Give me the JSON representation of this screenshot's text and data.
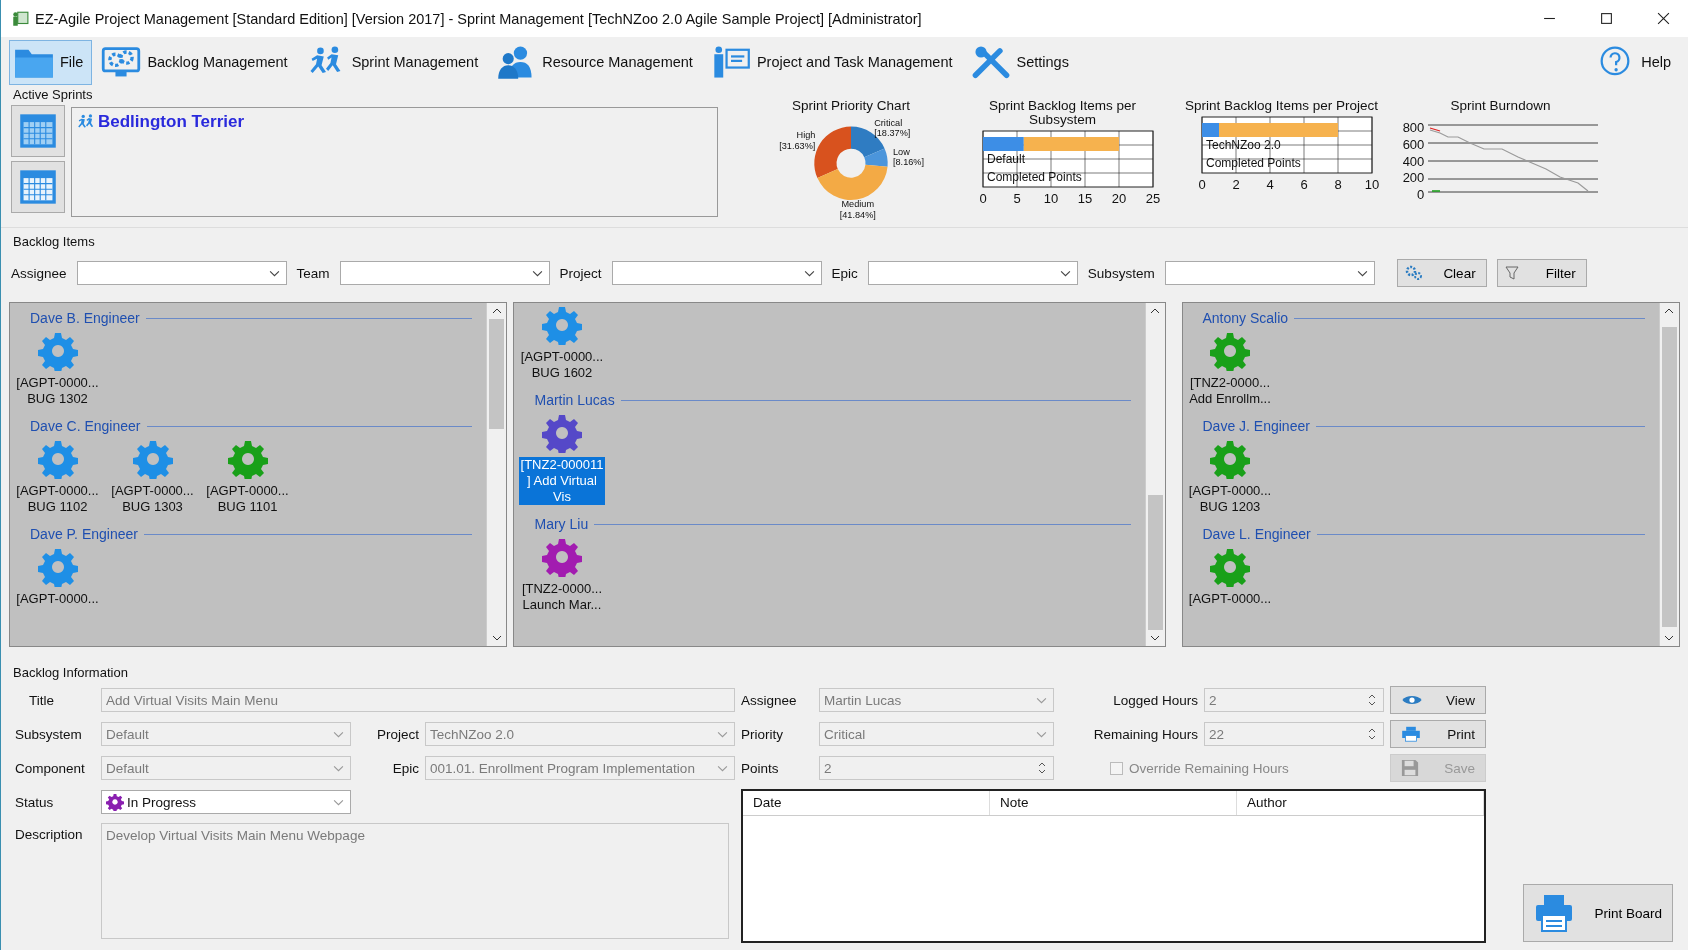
{
  "window": {
    "title": "EZ-Agile Project Management [Standard Edition] [Version 2017] - Sprint Management [TechNZoo 2.0 Agile Sample Project] [Administrator]"
  },
  "toolbar": [
    {
      "kind": "file",
      "label": "File",
      "selected": true
    },
    {
      "kind": "backlog",
      "label": "Backlog Management",
      "selected": false
    },
    {
      "kind": "sprint",
      "label": "Sprint Management",
      "selected": false
    },
    {
      "kind": "resource",
      "label": "Resource Management",
      "selected": false
    },
    {
      "kind": "project",
      "label": "Project and Task Management",
      "selected": false
    },
    {
      "kind": "settings",
      "label": "Settings",
      "selected": false
    }
  ],
  "help": {
    "label": "Help"
  },
  "active_sprints": {
    "label": "Active Sprints",
    "sprints": [
      "Bedlington Terrier"
    ]
  },
  "priority_chart": {
    "chart_data": {
      "type": "donut",
      "title": "Sprint Priority Chart",
      "categories": [
        "High",
        "Critical",
        "Low",
        "Medium"
      ],
      "series": [
        {
          "values": [
            31.63,
            18.37,
            8.16,
            41.84
          ]
        }
      ],
      "colors": [
        "#d8521e",
        "#2f7cc2",
        "#4b95db",
        "#f3aa45"
      ],
      "value_labels": [
        "[31.63%]",
        "[18.37%]",
        "[8.16%]",
        "[41.84%]"
      ]
    }
  },
  "subsystem_chart": {
    "chart_data": {
      "type": "bar",
      "orientation": "horizontal",
      "stacked": true,
      "title": "Sprint Backlog Items per Subsystem",
      "categories": [
        "Default"
      ],
      "series": [
        {
          "color": "#3d8ee6",
          "values": [
            6
          ]
        },
        {
          "name": "Completed Points",
          "color": "#f6b24e",
          "values": [
            14
          ]
        }
      ],
      "xlim": [
        0,
        25
      ],
      "xticks": [
        0,
        5,
        10,
        15,
        20,
        25
      ],
      "grid": true
    }
  },
  "project_chart": {
    "chart_data": {
      "type": "bar",
      "orientation": "horizontal",
      "stacked": true,
      "title": "Sprint Backlog Items per Project",
      "categories": [
        "TechNZoo 2.0"
      ],
      "series": [
        {
          "color": "#3d8ee6",
          "values": [
            1
          ]
        },
        {
          "name": "Completed Points",
          "color": "#f6b24e",
          "values": [
            7
          ]
        }
      ],
      "xlim": [
        0,
        10
      ],
      "xticks": [
        0,
        2,
        4,
        6,
        8,
        10
      ],
      "grid": true
    }
  },
  "burndown": {
    "title": "Sprint Burndown",
    "y_labels": [
      "800",
      "600",
      "400",
      "200",
      "0"
    ]
  },
  "backlog_items": {
    "label": "Backlog Items",
    "filters": [
      {
        "label": "Assignee"
      },
      {
        "label": "Team"
      },
      {
        "label": "Project"
      },
      {
        "label": "Epic"
      },
      {
        "label": "Subsystem"
      }
    ],
    "buttons": [
      {
        "kind": "clear",
        "label": "Clear"
      },
      {
        "kind": "filter",
        "label": "Filter"
      }
    ],
    "boards": [
      {
        "groups": [
          {
            "name": "Dave B. Engineer",
            "items": [
              {
                "lines": [
                  "[AGPT-0000...",
                  "BUG 1302"
                ],
                "color": "#1e8fe6",
                "selected": false
              }
            ]
          },
          {
            "name": "Dave C. Engineer",
            "items": [
              {
                "lines": [
                  "[AGPT-0000...",
                  "BUG 1102"
                ],
                "color": "#1e8fe6",
                "selected": false
              },
              {
                "lines": [
                  "[AGPT-0000...",
                  "BUG 1303"
                ],
                "color": "#1e8fe6",
                "selected": false
              },
              {
                "lines": [
                  "[AGPT-0000...",
                  "BUG 1101"
                ],
                "color": "#19a019",
                "selected": false
              }
            ]
          },
          {
            "name": "Dave P. Engineer",
            "items": [
              {
                "lines": [
                  "[AGPT-0000..."
                ],
                "color": "#1e8fe6",
                "selected": false
              }
            ]
          }
        ]
      },
      {
        "groups": [
          {
            "items": [
              {
                "lines": [
                  "[AGPT-0000...",
                  "BUG 1602"
                ],
                "color": "#1e8fe6",
                "selected": false
              }
            ]
          },
          {
            "name": "Martin Lucas",
            "items": [
              {
                "lines": [
                  "[TNZ2-000011",
                  "] Add Virtual",
                  "Vis"
                ],
                "color": "#5548c8",
                "selected": true
              }
            ]
          },
          {
            "name": "Mary Liu",
            "items": [
              {
                "lines": [
                  "[TNZ2-0000...",
                  "Launch Mar..."
                ],
                "color": "#a21cb0",
                "selected": false
              }
            ]
          }
        ]
      },
      {
        "groups": [
          {
            "name": "Antony Scalio",
            "items": [
              {
                "lines": [
                  "[TNZ2-0000...",
                  "Add Enrollm..."
                ],
                "color": "#19a019",
                "selected": false
              }
            ]
          },
          {
            "name": "Dave J. Engineer",
            "items": [
              {
                "lines": [
                  "[AGPT-0000...",
                  "BUG 1203"
                ],
                "color": "#19a019",
                "selected": false
              }
            ]
          },
          {
            "name": "Dave L. Engineer",
            "items": [
              {
                "lines": [
                  "[AGPT-0000..."
                ],
                "color": "#19a019",
                "selected": false
              }
            ]
          }
        ]
      }
    ]
  },
  "backlog_info": {
    "label": "Backlog Information",
    "title": {
      "label": "Title",
      "value": "Add Virtual Visits Main Menu"
    },
    "subsystem": {
      "label": "Subsystem",
      "value": "Default"
    },
    "component": {
      "label": "Component",
      "value": "Default"
    },
    "status": {
      "label": "Status",
      "value": "In Progress"
    },
    "description": {
      "label": "Description",
      "value": "Develop Virtual Visits Main Menu Webpage"
    },
    "project": {
      "label": "Project",
      "value": "TechNZoo 2.0"
    },
    "epic": {
      "label": "Epic",
      "value": "001.01. Enrollment Program Implementation"
    },
    "assignee": {
      "label": "Assignee",
      "value": "Martin Lucas"
    },
    "priority": {
      "label": "Priority",
      "value": "Critical"
    },
    "points": {
      "label": "Points",
      "value": "2"
    },
    "logged_hours": {
      "label": "Logged Hours",
      "value": "2"
    },
    "remaining_hours": {
      "label": "Remaining Hours",
      "value": "22"
    },
    "override": {
      "label": "Override Remaining Hours",
      "checked": false,
      "disabled": true
    },
    "buttons": [
      {
        "kind": "view",
        "label": "View",
        "disabled": false
      },
      {
        "kind": "print",
        "label": "Print",
        "disabled": false
      },
      {
        "kind": "save",
        "label": "Save",
        "disabled": true
      }
    ],
    "notes_table": {
      "columns": [
        "Date",
        "Note",
        "Author"
      ]
    },
    "print_board": {
      "label": "Print Board"
    }
  }
}
